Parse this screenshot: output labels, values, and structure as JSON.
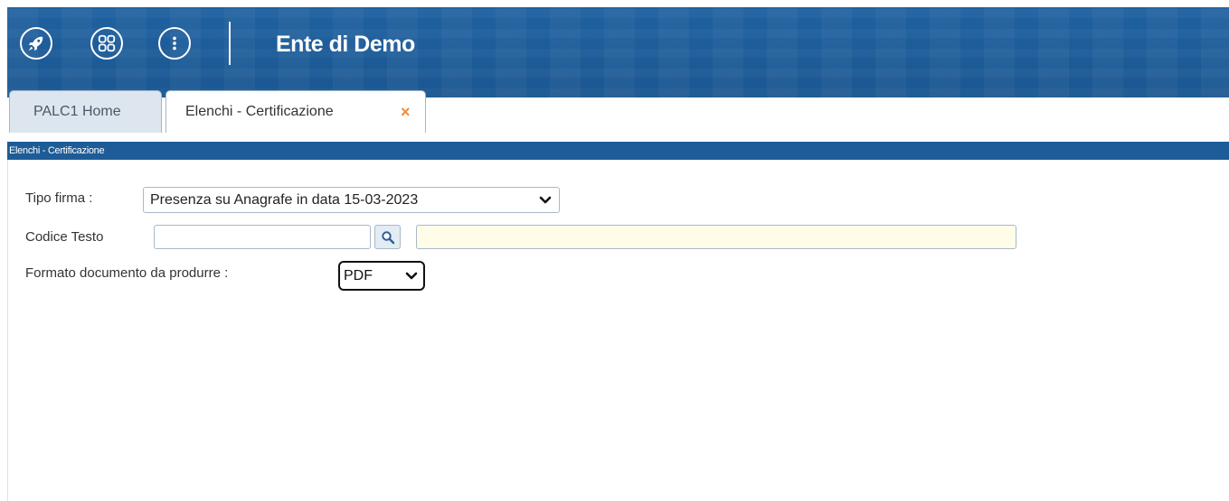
{
  "header": {
    "title": "Ente di Demo",
    "buttons": [
      {
        "icon": "rocket-icon"
      },
      {
        "icon": "apps-grid-icon"
      },
      {
        "icon": "more-vertical-icon"
      }
    ]
  },
  "tabs": [
    {
      "label": "PALC1 Home",
      "active": false
    },
    {
      "label": "Elenchi - Certificazione",
      "active": true,
      "closable": true,
      "close_symbol": "×"
    }
  ],
  "breadcrumb": "Elenchi - Certificazione",
  "form": {
    "tipo_firma": {
      "label": "Tipo firma :",
      "value": "Presenza su Anagrafe in data 15-03-2023"
    },
    "codice_testo": {
      "label": "Codice Testo",
      "value": "",
      "description": ""
    },
    "formato": {
      "label": "Formato documento da produrre :",
      "value": "PDF"
    }
  },
  "colors": {
    "header_blue": "#1d5c97",
    "accent_orange": "#f08a3c",
    "description_field": "#fffde8"
  }
}
